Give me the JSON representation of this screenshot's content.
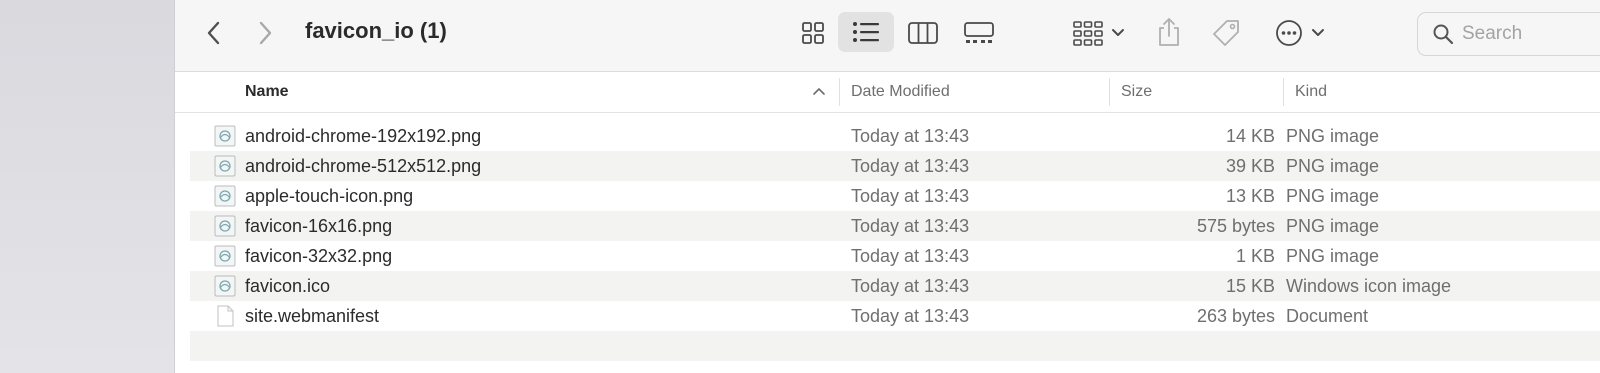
{
  "window": {
    "title": "favicon_io (1)"
  },
  "toolbar": {
    "back": "chevron-left-icon",
    "forward": "chevron-right-icon",
    "views": [
      "icon-view",
      "list-view",
      "column-view",
      "gallery-view"
    ],
    "active_view": "list-view",
    "group": "group-icon",
    "share": "share-icon",
    "tags": "tag-icon",
    "more": "ellipsis-circle-icon"
  },
  "search": {
    "placeholder": "Search"
  },
  "columns": {
    "name": "Name",
    "date": "Date Modified",
    "size": "Size",
    "kind": "Kind",
    "sort": "ascending"
  },
  "files": [
    {
      "name": "android-chrome-192x192.png",
      "date": "Today at 13:43",
      "size": "14 KB",
      "kind": "PNG image",
      "icon": "image-file-icon"
    },
    {
      "name": "android-chrome-512x512.png",
      "date": "Today at 13:43",
      "size": "39 KB",
      "kind": "PNG image",
      "icon": "image-file-icon"
    },
    {
      "name": "apple-touch-icon.png",
      "date": "Today at 13:43",
      "size": "13 KB",
      "kind": "PNG image",
      "icon": "image-file-icon"
    },
    {
      "name": "favicon-16x16.png",
      "date": "Today at 13:43",
      "size": "575 bytes",
      "kind": "PNG image",
      "icon": "image-file-icon"
    },
    {
      "name": "favicon-32x32.png",
      "date": "Today at 13:43",
      "size": "1 KB",
      "kind": "PNG image",
      "icon": "image-file-icon"
    },
    {
      "name": "favicon.ico",
      "date": "Today at 13:43",
      "size": "15 KB",
      "kind": "Windows icon image",
      "icon": "image-file-icon"
    },
    {
      "name": "site.webmanifest",
      "date": "Today at 13:43",
      "size": "263 bytes",
      "kind": "Document",
      "icon": "document-icon"
    }
  ],
  "colors": {
    "sidebar": "#dcdce0",
    "toolbar": "#f6f6f6",
    "alt_row": "#f3f3f2"
  }
}
